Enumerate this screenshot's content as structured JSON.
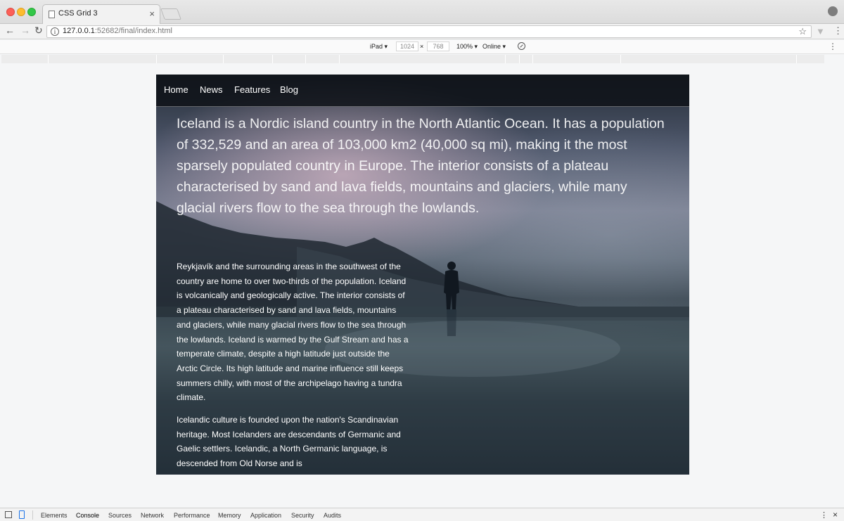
{
  "browser": {
    "tab_title": "CSS Grid 3",
    "tab_close": "×",
    "url_host": "127.0.0.1",
    "url_path": ":52682/final/index.html",
    "icons": [
      "back-icon",
      "forward-icon",
      "reload-icon",
      "info-icon",
      "star-icon",
      "extension-icon",
      "menu-icon",
      "profile-icon"
    ]
  },
  "device_toolbar": {
    "device": "iPad ▾",
    "width": "1024",
    "times": "×",
    "height": "768",
    "zoom": "100% ▾",
    "network": "Online ▾"
  },
  "site": {
    "nav": [
      "Home",
      "News",
      "Features",
      "Blog"
    ],
    "intro": "Iceland is a Nordic island country in the North Atlantic Ocean. It has a population of 332,529 and an area of 103,000 km2 (40,000 sq mi), making it the most sparsely populated country in Europe. The interior consists of a plateau characterised by sand and lava fields, mountains and glaciers, while many glacial rivers flow to the sea through the lowlands.",
    "paragraphs": [
      "Reykjavík and the surrounding areas in the southwest of the country are home to over two-thirds of the population. Iceland is volcanically and geologically active. The interior consists of a plateau characterised by sand and lava fields, mountains and glaciers, while many glacial rivers flow to the sea through the lowlands. Iceland is warmed by the Gulf Stream and has a temperate climate, despite a high latitude just outside the Arctic Circle. Its high latitude and marine influence still keeps summers chilly, with most of the archipelago having a tundra climate.",
      "Icelandic culture is founded upon the nation's Scandinavian heritage. Most Icelanders are descendants of Germanic and Gaelic settlers. Icelandic, a North Germanic language, is descended from Old Norse and is"
    ]
  },
  "devtools": {
    "tabs": [
      "Elements",
      "Console",
      "Sources",
      "Network",
      "Performance",
      "Memory",
      "Application",
      "Security",
      "Audits"
    ],
    "active_tab": "Console",
    "close": "×"
  },
  "colors": {
    "accent": "#1a73e8",
    "nav_bg": "#0e1218"
  }
}
